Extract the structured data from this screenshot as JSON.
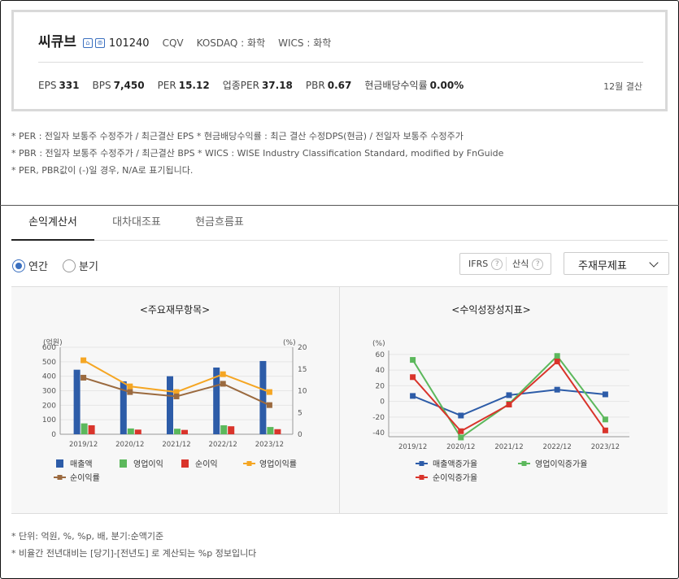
{
  "company": {
    "name": "씨큐브",
    "icon1": "home-icon",
    "icon2": "ir-icon",
    "code": "101240",
    "eng": "CQV",
    "market": "KOSDAQ : 화학",
    "wics": "WICS : 화학"
  },
  "indicators": [
    {
      "label": "EPS",
      "value": "331"
    },
    {
      "label": "BPS",
      "value": "7,450"
    },
    {
      "label": "PER",
      "value": "15.12"
    },
    {
      "label": "업종PER",
      "value": "37.18"
    },
    {
      "label": "PBR",
      "value": "0.67"
    },
    {
      "label": "현금배당수익률",
      "value": "0.00%"
    }
  ],
  "settlement": "12월 결산",
  "notes": [
    "* PER : 전일자 보통주 수정주가 / 최근결산 EPS * 현금배당수익률 : 최근 결산 수정DPS(현금) / 전일자 보통주 수정주가",
    "* PBR : 전일자 보통주 수정주가 / 최근결산 BPS * WICS : WISE Industry Classification Standard, modified by FnGuide",
    "* PER, PBR값이 (-)일 경우, N/A로 표기됩니다."
  ],
  "tabs": [
    "손익계산서",
    "대차대조표",
    "현금흐름표"
  ],
  "radios": [
    "연간",
    "분기"
  ],
  "options": {
    "ifrs": "IFRS",
    "calc": "산식",
    "help": "?"
  },
  "select": {
    "value": "주재무제표"
  },
  "chart_data": [
    {
      "type": "bar",
      "title": "<주요재무항목>",
      "ylabel_left": "(억원)",
      "ylabel_right": "(%)",
      "categories": [
        "2019/12",
        "2020/12",
        "2021/12",
        "2022/12",
        "2023/12"
      ],
      "ylim_left": [
        0,
        600
      ],
      "yticks_left": [
        0,
        100,
        200,
        300,
        400,
        500,
        600
      ],
      "ylim_right": [
        0,
        20
      ],
      "yticks_right": [
        0,
        5,
        10,
        15,
        20
      ],
      "series": [
        {
          "name": "매출액",
          "kind": "bar",
          "axis": "left",
          "color": "#2d5ca8",
          "values": [
            445,
            365,
            400,
            460,
            505
          ]
        },
        {
          "name": "영업이익",
          "kind": "bar",
          "axis": "left",
          "color": "#5cb85c",
          "values": [
            75,
            40,
            38,
            62,
            50
          ]
        },
        {
          "name": "순이익",
          "kind": "bar",
          "axis": "left",
          "color": "#d9342b",
          "values": [
            62,
            32,
            30,
            55,
            35
          ]
        },
        {
          "name": "영업이익률",
          "kind": "line",
          "axis": "right",
          "color": "#f5a623",
          "values": [
            17.0,
            11.0,
            9.7,
            13.8,
            9.7
          ]
        },
        {
          "name": "순이익률",
          "kind": "line",
          "axis": "right",
          "color": "#9b6a3f",
          "values": [
            13.0,
            9.7,
            8.7,
            11.6,
            6.7
          ]
        }
      ]
    },
    {
      "type": "line",
      "title": "<수익성장성지표>",
      "ylabel": "(%)",
      "categories": [
        "2019/12",
        "2020/12",
        "2021/12",
        "2022/12",
        "2023/12"
      ],
      "ylim": [
        -45,
        65
      ],
      "yticks": [
        -40,
        -20,
        0,
        20,
        40,
        60
      ],
      "series": [
        {
          "name": "매출액증가율",
          "color": "#2d5ca8",
          "values": [
            7,
            -18,
            8,
            15,
            9
          ]
        },
        {
          "name": "영업이익증가율",
          "color": "#5cb85c",
          "values": [
            53,
            -46,
            -3,
            58,
            -23
          ]
        },
        {
          "name": "순이익증가율",
          "color": "#d9342b",
          "values": [
            31,
            -38,
            -4,
            51,
            -37
          ]
        }
      ]
    }
  ],
  "footnotes": [
    "* 단위: 억원, %, %p, 배, 분기:순액기준",
    "* 비율간 전년대비는 [당기]-[전년도] 로 계산되는 %p 정보입니다"
  ]
}
